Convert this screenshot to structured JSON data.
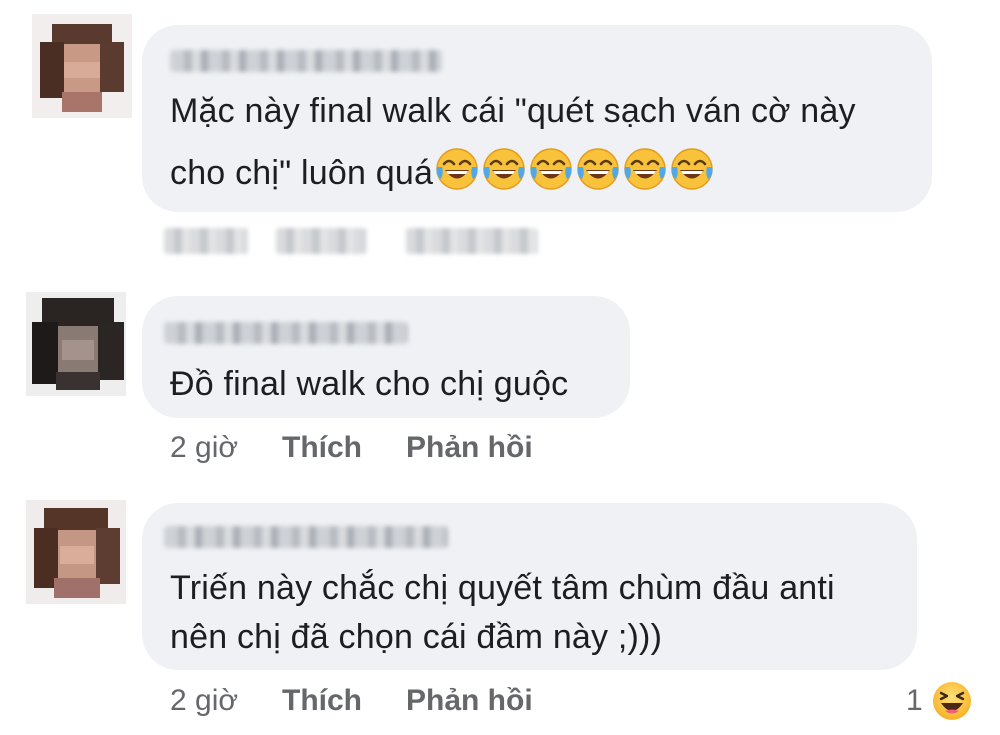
{
  "comments": [
    {
      "lines": [
        "Mặc này final walk cái \"quét sạch ván cờ này",
        "cho chị\" luôn quá"
      ],
      "emoji_count": 6,
      "emoji_name": "laughing-tears-emoji"
    },
    {
      "lines": [
        "Đồ final walk cho chị guộc"
      ],
      "time": "2 giờ",
      "like_label": "Thích",
      "reply_label": "Phản hồi"
    },
    {
      "lines": [
        "Triến này chắc chị quyết tâm chùm đầu anti",
        "nên chị đã chọn cái đầm này ;)))"
      ],
      "time": "2 giờ",
      "like_label": "Thích",
      "reply_label": "Phản hồi",
      "reaction_count": "1",
      "reaction_icon": "haha-emoji"
    }
  ]
}
